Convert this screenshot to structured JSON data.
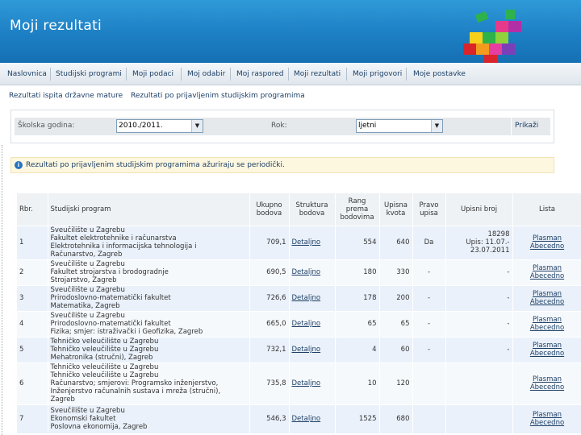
{
  "header": {
    "title": "Moji rezultati"
  },
  "nav": {
    "items": [
      "Naslovnica",
      "Studijski programi",
      "Moji podaci",
      "Moj odabir",
      "Moj raspored",
      "Moji rezultati",
      "Moji prigovori",
      "Moje postavke"
    ]
  },
  "sublinks": [
    "Rezultati ispita državne mature",
    "Rezultati po prijavljenim studijskim programima"
  ],
  "filter": {
    "year_label": "Školska godina:",
    "year_value": "2010./2011.",
    "term_label": "Rok:",
    "term_value": "ljetni",
    "show_label": "Prikaži"
  },
  "notice": {
    "text": "Rezultati po prijavljenim studijskim programima ažuriraju se periodički."
  },
  "table": {
    "headers": {
      "rbr": "Rbr.",
      "program": "Studijski program",
      "ukupno": "Ukupno\nbodova",
      "struktura": "Struktura\nbodova",
      "rang": "Rang\nprema\nbodovima",
      "kvota": "Upisna\nkvota",
      "pravo": "Pravo\nupisa",
      "upisni": "Upisni broj",
      "lista": "Lista"
    },
    "rows": [
      {
        "rbr": "1",
        "program": "Sveučilište u Zagrebu\nFakultet elektrotehnike i računarstva\nElektrotehnika i informacijska tehnologija i\nRačunarstvo, Zagreb",
        "ukupno": "709,1",
        "struktura": "Detaljno",
        "rang": "554",
        "kvota": "640",
        "pravo": "Da",
        "upisni": "18298\nUpis: 11.07.-\n23.07.2011",
        "lista1": "Plasman",
        "lista2": "Abecedno"
      },
      {
        "rbr": "2",
        "program": "Sveučilište u Zagrebu\nFakultet strojarstva i brodogradnje\nStrojarstvo, Zagreb",
        "ukupno": "690,5",
        "struktura": "Detaljno",
        "rang": "180",
        "kvota": "330",
        "pravo": "-",
        "upisni": "-",
        "lista1": "Plasman",
        "lista2": "Abecedno"
      },
      {
        "rbr": "3",
        "program": "Sveučilište u Zagrebu\nPrirodoslovno-matematički fakultet\nMatematika, Zagreb",
        "ukupno": "726,6",
        "struktura": "Detaljno",
        "rang": "178",
        "kvota": "200",
        "pravo": "-",
        "upisni": "-",
        "lista1": "Plasman",
        "lista2": "Abecedno"
      },
      {
        "rbr": "4",
        "program": "Sveučilište u Zagrebu\nPrirodoslovno-matematički fakultet\nFizika; smjer: istraživački i Geofizika, Zagreb",
        "ukupno": "665,0",
        "struktura": "Detaljno",
        "rang": "65",
        "kvota": "65",
        "pravo": "-",
        "upisni": "-",
        "lista1": "Plasman",
        "lista2": "Abecedno"
      },
      {
        "rbr": "5",
        "program": "Tehničko veleučilište u Zagrebu\nTehničko veleučilište u Zagrebu\nMehatronika (stručni), Zagreb",
        "ukupno": "732,1",
        "struktura": "Detaljno",
        "rang": "4",
        "kvota": "60",
        "pravo": "-",
        "upisni": "-",
        "lista1": "Plasman",
        "lista2": "Abecedno"
      },
      {
        "rbr": "6",
        "program": "Tehničko veleučilište u Zagrebu\nTehničko veleučilište u Zagrebu\nRačunarstvo; smjerovi: Programsko inženjerstvo,\nInženjerstvo računalnih sustava i mreža (stručni),\nZagreb",
        "ukupno": "735,8",
        "struktura": "Detaljno",
        "rang": "10",
        "kvota": "120",
        "pravo": "",
        "upisni": "",
        "lista1": "Plasman",
        "lista2": "Abecedno"
      },
      {
        "rbr": "7",
        "program": "Sveučilište u Zagrebu\nEkonomski fakultet\nPoslovna ekonomija, Zagreb",
        "ukupno": "546,3",
        "struktura": "Detaljno",
        "rang": "1525",
        "kvota": "680",
        "pravo": "",
        "upisni": "",
        "lista1": "Plasman",
        "lista2": "Abecedno"
      }
    ]
  }
}
